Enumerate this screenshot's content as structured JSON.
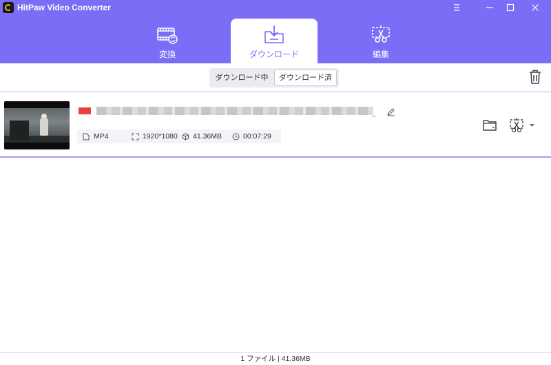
{
  "window": {
    "title": "HitPaw Video Converter",
    "accent_color": "#7b6ef6"
  },
  "titlebar": {
    "icons": [
      "menu-icon",
      "minimize-icon",
      "maximize-icon",
      "close-icon"
    ]
  },
  "tabs": [
    {
      "label": "変換",
      "icon": "film-convert-icon",
      "active": false
    },
    {
      "label": "ダウンロード",
      "icon": "download-folder-icon",
      "active": true
    },
    {
      "label": "編集",
      "icon": "edit-cut-icon",
      "active": false
    }
  ],
  "download_filter": {
    "options": [
      "ダウンロード中",
      "ダウンロード済"
    ],
    "selected": "ダウンロード済"
  },
  "toolbar": {
    "trash_icon": "trash-icon"
  },
  "items": [
    {
      "thumbnail": "video-thumbnail",
      "meta": {
        "format": "MP4",
        "resolution": "1920*1080",
        "size": "41.36MB",
        "duration": "00:07:29"
      }
    }
  ],
  "footer": {
    "status": "1 ファイル | 41.36MB"
  }
}
